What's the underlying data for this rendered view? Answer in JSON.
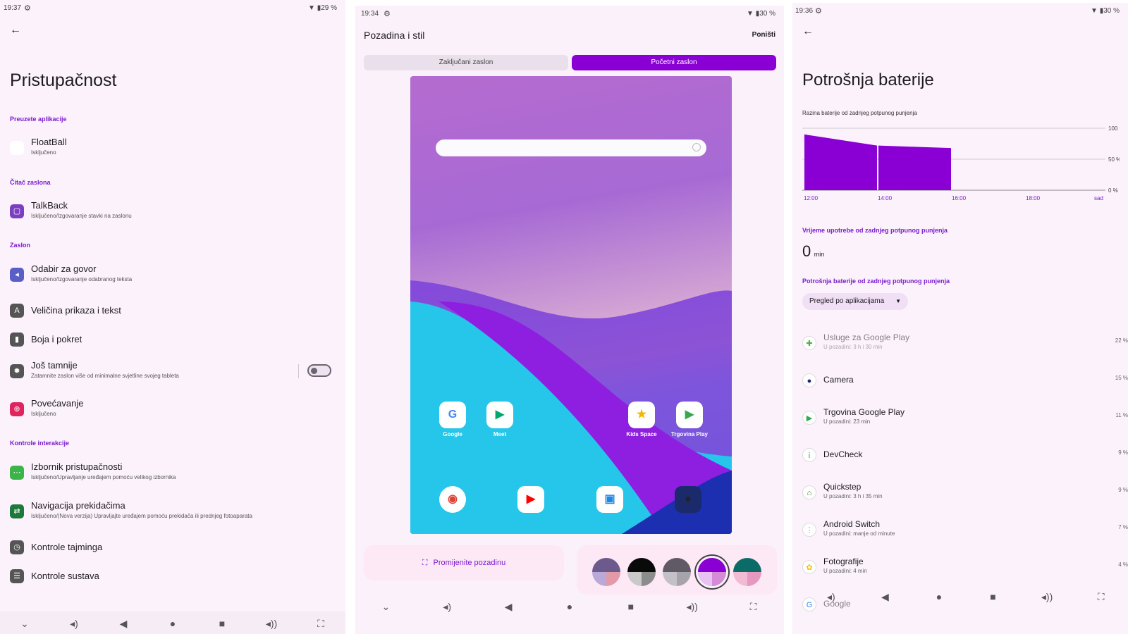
{
  "panel1": {
    "status": {
      "time": "19:37",
      "gear": "⚙",
      "right": "▼ ▮29 %"
    },
    "back_icon": "←",
    "title": "Pristupačnost",
    "sections": {
      "downloaded": "Preuzete aplikacije",
      "reader": "Čitač zaslona",
      "display": "Zaslon",
      "interaction": "Kontrole interakcije"
    },
    "items": {
      "floatball": {
        "title": "FloatBall",
        "sub": "Isključeno"
      },
      "talkback": {
        "title": "TalkBack",
        "sub": "Isključeno/Izgovaranje stavki na zaslonu"
      },
      "select_to_speak": {
        "title": "Odabir za govor",
        "sub": "Isključeno/Izgovaranje odabranog teksta"
      },
      "display_size": {
        "title": "Veličina prikaza i tekst"
      },
      "color_motion": {
        "title": "Boja i pokret"
      },
      "extra_dim": {
        "title": "Još tamnije",
        "sub": "Zatamnite zaslon više od minimalne svjetline svojeg tableta",
        "toggle": false
      },
      "magnification": {
        "title": "Povećavanje",
        "sub": "Isključeno"
      },
      "a11y_menu": {
        "title": "Izbornik pristupačnosti",
        "sub": "Isključeno/Upravljanje uređajem pomoću velikog izbornika"
      },
      "switch_access": {
        "title": "Navigacija prekidačima",
        "sub": "Isključeno/(Nova verzija) Upravljajte uređajem pomoću prekidača ili prednjeg fotoaparata"
      },
      "timing": {
        "title": "Kontrole tajminga"
      },
      "system_controls": {
        "title": "Kontrole sustava"
      }
    },
    "navbar": [
      "⌄",
      "◂)",
      "◀",
      "●",
      "■",
      "◂))",
      "⛶"
    ]
  },
  "panel2": {
    "status": {
      "time": "19:34",
      "gear": "⚙",
      "right": "▼ ▮30 %"
    },
    "title": "Pozadina i stil",
    "cancel": "Poništi",
    "tabs": {
      "lock": "Zaključani zaslon",
      "home": "Početni zaslon"
    },
    "apps_row1": [
      {
        "label": "Google",
        "glyph": "G",
        "color": "#4285f4"
      },
      {
        "label": "Meet",
        "glyph": "▶",
        "color": "#00a86b"
      },
      {
        "label": "Kids Space",
        "glyph": "★",
        "color": "#f4b400"
      },
      {
        "label": "Trgovina Play",
        "glyph": "▶",
        "color": "#34a853"
      }
    ],
    "apps_row2": [
      {
        "glyph": "◉",
        "color": "#db4437"
      },
      {
        "glyph": "▶",
        "color": "#ff0000"
      },
      {
        "glyph": "▣",
        "color": "#1e88e5"
      },
      {
        "glyph": "●",
        "color": "#222222"
      }
    ],
    "change_wallpaper": "Promijenite pozadinu",
    "swatches": [
      {
        "top": "#6d5a8d",
        "bl": "#b9a9d8",
        "br": "#e29aa8",
        "selected": false
      },
      {
        "top": "#0a0a0a",
        "bl": "#c9c9c9",
        "br": "#8c8c8c",
        "selected": false
      },
      {
        "top": "#5f5a66",
        "bl": "#c4c0c8",
        "br": "#a7a3ad",
        "selected": false
      },
      {
        "top": "#8a00d4",
        "bl": "#e6c3f2",
        "br": "#d68bd6",
        "selected": true
      },
      {
        "top": "#0c6b66",
        "bl": "#f1bcd3",
        "br": "#e598c0",
        "selected": false
      }
    ],
    "navbar": [
      "⌄",
      "◂)",
      "◀",
      "●",
      "■",
      "◂))",
      "⛶"
    ]
  },
  "panel3": {
    "status": {
      "time": "19:36",
      "gear": "⚙",
      "right": "▼ ▮30 %"
    },
    "back_icon": "←",
    "title": "Potrošnja baterije",
    "chart_caption": "Razina baterije od zadnjeg potpunog punjenja",
    "usage_label": "Vrijeme upotrebe od zadnjeg potpunog punjenja",
    "usage_value": "0",
    "usage_unit": "min",
    "consumption_label": "Potrošnja baterije od zadnjeg potpunog punjenja",
    "dropdown": "Pregled po aplikacijama",
    "apps": [
      {
        "title": "Usluge za Google Play",
        "sub": "U pozadini: 3 h i 30 min",
        "value": "22 %",
        "glyph": "✚",
        "color": "#4caf50",
        "dim": true
      },
      {
        "title": "Camera",
        "sub": "",
        "value": "15 %",
        "glyph": "●",
        "color": "#1a237e",
        "dim": false
      },
      {
        "title": "Trgovina Google Play",
        "sub": "U pozadini: 23 min",
        "value": "11 %",
        "glyph": "▶",
        "color": "#34a853",
        "dim": false
      },
      {
        "title": "DevCheck",
        "sub": "",
        "value": "9 %",
        "glyph": "i",
        "color": "#43a047",
        "dim": false
      },
      {
        "title": "Quickstep",
        "sub": "U pozadini: 3 h i 35 min",
        "value": "9 %",
        "glyph": "⌂",
        "color": "#2e7d32",
        "dim": false
      },
      {
        "title": "Android Switch",
        "sub": "U pozadini: manje od minute",
        "value": "7 %",
        "glyph": "⋮",
        "color": "#9e9e9e",
        "dim": false
      },
      {
        "title": "Fotografije",
        "sub": "U pozadini: 4 min",
        "value": "4 %",
        "glyph": "✿",
        "color": "#fbbc05",
        "dim": false
      },
      {
        "title": "Google",
        "sub": "",
        "value": "",
        "glyph": "G",
        "color": "#4285f4",
        "dim": true
      }
    ],
    "navbar": [
      "⌄",
      "◂)",
      "◀",
      "●",
      "■",
      "◂))",
      "⛶"
    ],
    "chart_data": {
      "type": "area",
      "title": "Razina baterije od zadnjeg potpunog punjenja",
      "x": [
        "12:00",
        "14:00",
        "16:00",
        "18:00",
        "sad"
      ],
      "y_ticks": [
        "100 %",
        "50 %",
        "0 %"
      ],
      "ylim": [
        0,
        100
      ],
      "series": [
        {
          "segments": [
            {
              "from": "12:00",
              "to": "14:00",
              "start": 90,
              "end": 72
            },
            {
              "from": "14:00",
              "to": "16:00",
              "start": 72,
              "end": 68
            }
          ]
        }
      ],
      "color": "#8a00d4"
    }
  }
}
